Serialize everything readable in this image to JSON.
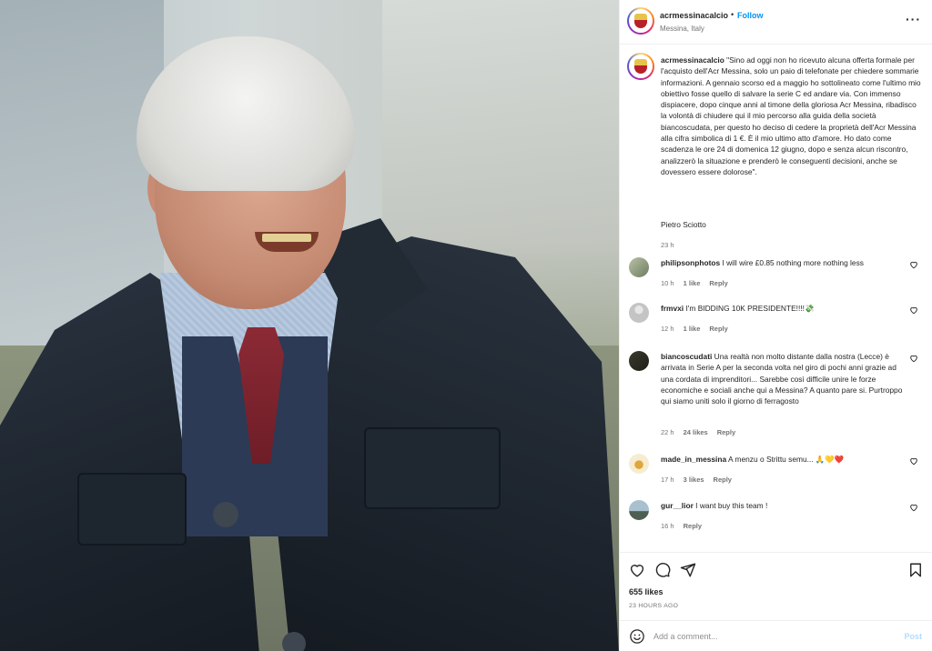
{
  "post": {
    "username": "acrmessinacalcio",
    "separator": "•",
    "follow_label": "Follow",
    "location": "Messina, Italy",
    "more_icon": "more-horizontal-icon"
  },
  "caption": {
    "username": "acrmessinacalcio",
    "text": "\"Sino ad oggi non ho ricevuto alcuna offerta formale per l'acquisto dell'Acr Messina, solo un paio di telefonate per chiedere sommarie informazioni. A gennaio scorso ed a maggio ho sottolineato come l'ultimo mio obiettivo fosse quello di salvare la serie C ed andare via. Con immenso dispiacere, dopo cinque anni al timone della gloriosa Acr Messina, ribadisco la volontà di chiudere qui il mio percorso alla guida della società biancoscudata, per questo ho deciso di cedere la proprietà dell'Acr Messina alla cifra simbolica di 1 €. È il mio ultimo atto d'amore. Ho dato come scadenza le ore 24 di domenica 12 giugno, dopo e senza alcun riscontro, analizzerò la situazione e prenderò le conseguenti decisioni, anche se dovessero essere dolorose\".",
    "signature": "Pietro Sciotto",
    "time": "23 h"
  },
  "comments": [
    {
      "username": "philipsonphotos",
      "text": "I will wire £0.85 nothing more nothing less",
      "time": "10 h",
      "likes": "1 like",
      "reply": "Reply",
      "avatar_color": "#8a9a7a"
    },
    {
      "username": "frmvxi",
      "text": "I'm BIDDING 10K PRESIDENTE!!!!💸",
      "time": "12 h",
      "likes": "1 like",
      "reply": "Reply",
      "avatar_color": "#c9c9c9"
    },
    {
      "username": "biancoscudati",
      "text": "Una realtà non molto distante dalla nostra (Lecce) è arrivata in Serie A per la seconda volta nel giro di pochi anni grazie ad una cordata di imprenditori... Sarebbe così difficile unire le forze economiche e sociali anche qui a Messina? A quanto pare si. Purtroppo qui siamo uniti solo il giorno di ferragosto",
      "time": "22 h",
      "likes": "24 likes",
      "reply": "Reply",
      "avatar_color": "#2b2b22"
    },
    {
      "username": "made_in_messina",
      "text": "A menzu o Strittu semu... 🙏💛❤️",
      "time": "17 h",
      "likes": "3 likes",
      "reply": "Reply",
      "avatar_color": "#f0e2b8"
    },
    {
      "username": "gur__lior",
      "text": "I want buy this team !",
      "time": "16 h",
      "likes": "",
      "reply": "Reply",
      "avatar_color": "#7f97a6"
    }
  ],
  "actions": {
    "likes": "655 likes",
    "ago": "23 HOURS AGO"
  },
  "add_comment": {
    "placeholder": "Add a comment...",
    "post_label": "Post"
  }
}
